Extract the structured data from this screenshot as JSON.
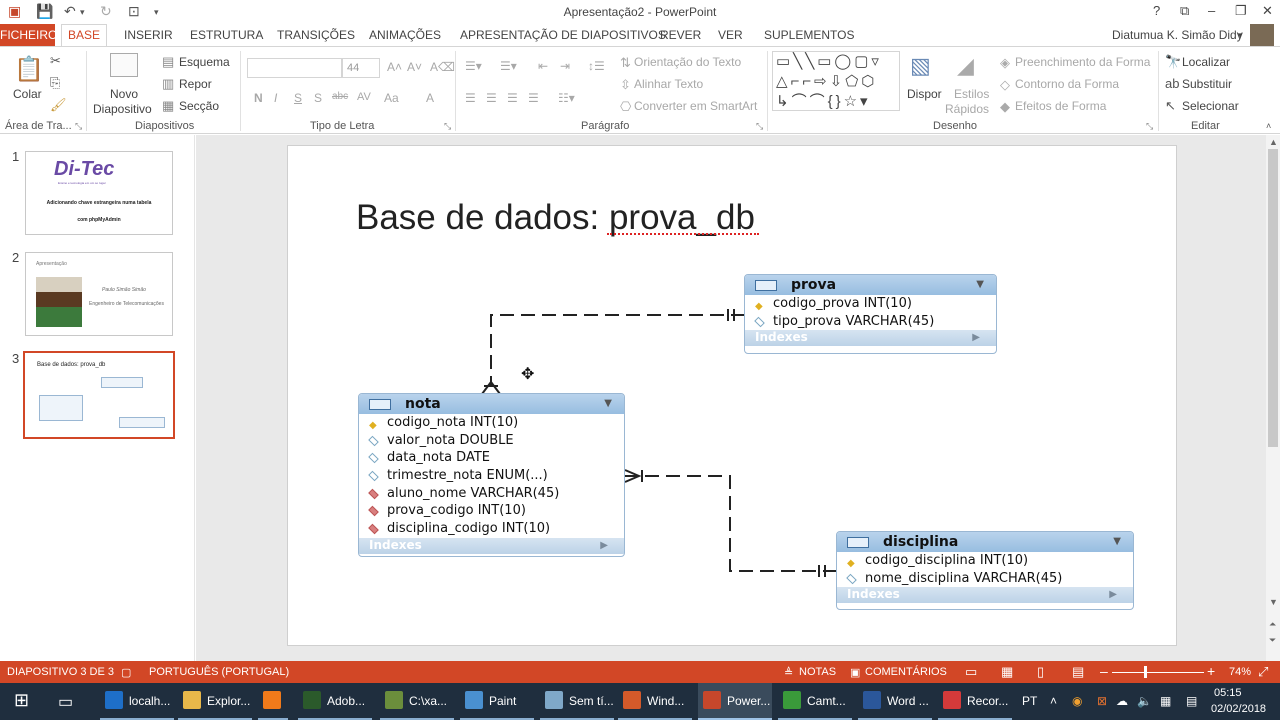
{
  "window": {
    "title": "Apresentação2 - PowerPoint",
    "controls": {
      "help": "?",
      "restore": "⧉",
      "minimize": "–",
      "maximize": "❐",
      "close": "✕"
    }
  },
  "quick_access": {
    "save_icon": "save-icon",
    "undo_icon": "undo-icon",
    "redo_icon": "redo-icon",
    "presentation_icon": "start-from-beginning-icon"
  },
  "tabs": [
    "FICHEIRO",
    "BASE",
    "INSERIR",
    "ESTRUTURA",
    "TRANSIÇÕES",
    "ANIMAÇÕES",
    "APRESENTAÇÃO DE DIAPOSITIVOS",
    "REVER",
    "VER",
    "SUPLEMENTOS"
  ],
  "user": {
    "name": "Diatumua K. Simão Didy"
  },
  "ribbon": {
    "clipboard": {
      "paste": "Colar",
      "group": "Área de Tra..."
    },
    "slides": {
      "new_slide_1": "Novo",
      "new_slide_2": "Diapositivo",
      "layout": "Esquema",
      "reset": "Repor",
      "section": "Secção",
      "group": "Diapositivos"
    },
    "font": {
      "size": "44",
      "bold": "N",
      "italic": "I",
      "underline": "S",
      "shadow": "S",
      "strike": "abc",
      "spacing": "AV",
      "case": "Aa",
      "color": "A",
      "group": "Tipo de Letra"
    },
    "paragraph": {
      "text_direction": "Orientação do Texto",
      "align_text": "Alinhar Texto",
      "smartart": "Converter em SmartArt",
      "group": "Parágrafo"
    },
    "drawing": {
      "arrange": "Dispor",
      "quick_styles_1": "Estilos",
      "quick_styles_2": "Rápidos",
      "fill": "Preenchimento da Forma",
      "outline": "Contorno da Forma",
      "effects": "Efeitos de Forma",
      "group": "Desenho"
    },
    "editing": {
      "find": "Localizar",
      "replace": "Substituir",
      "select": "Selecionar",
      "group": "Editar"
    }
  },
  "slides_panel": [
    {
      "num": "1",
      "logo": "Di-Tec",
      "tagline": "Ensino e tecnologia em um so lugar",
      "line1": "Adicionando chave estrangeira numa tabela",
      "line2": "com phpMyAdmin"
    },
    {
      "num": "2",
      "header": "Apresentação",
      "name": "Paulo Simão Simão",
      "role": "Engenheiro de Telecomunicações"
    },
    {
      "num": "3",
      "title": "Base de dados: prova_db",
      "selected": true
    }
  ],
  "slide": {
    "title": "Base de dados: prova_db",
    "tables": {
      "prova": {
        "name": "prova",
        "indexes": "Indexes",
        "columns": [
          {
            "text": "codigo_prova INT(10)",
            "kind": "pk"
          },
          {
            "text": "tipo_prova VARCHAR(45)",
            "kind": "col"
          }
        ]
      },
      "nota": {
        "name": "nota",
        "indexes": "Indexes",
        "columns": [
          {
            "text": "codigo_nota INT(10)",
            "kind": "pk"
          },
          {
            "text": "valor_nota DOUBLE",
            "kind": "col"
          },
          {
            "text": "data_nota DATE",
            "kind": "col"
          },
          {
            "text": "trimestre_nota ENUM(...)",
            "kind": "col"
          },
          {
            "text": "aluno_nome VARCHAR(45)",
            "kind": "fk"
          },
          {
            "text": "prova_codigo INT(10)",
            "kind": "fk"
          },
          {
            "text": "disciplina_codigo INT(10)",
            "kind": "fk"
          }
        ]
      },
      "disciplina": {
        "name": "disciplina",
        "indexes": "Indexes",
        "columns": [
          {
            "text": "codigo_disciplina INT(10)",
            "kind": "pk"
          },
          {
            "text": "nome_disciplina VARCHAR(45)",
            "kind": "col"
          }
        ]
      }
    }
  },
  "statusbar": {
    "slide_info": "DIAPOSITIVO 3 DE 3",
    "language": "PORTUGUÊS (PORTUGAL)",
    "notes": "NOTAS",
    "comments": "COMENTÁRIOS",
    "zoom": "74%"
  },
  "taskbar": {
    "items": [
      {
        "label": "localh...",
        "color": "#1e6fc8"
      },
      {
        "label": "Explor...",
        "color": "#e8b84a"
      },
      {
        "label": "",
        "color": "#f07a1a"
      },
      {
        "label": "Adob...",
        "color": "#2b5a2b"
      },
      {
        "label": "C:\\xa...",
        "color": "#6b8e3c"
      },
      {
        "label": "Paint",
        "color": "#4a90d0"
      },
      {
        "label": "Sem tí...",
        "color": "#7fa8c8"
      },
      {
        "label": "Wind...",
        "color": "#d45a2a"
      },
      {
        "label": "Power...",
        "color": "#c6472b"
      },
      {
        "label": "Camt...",
        "color": "#3a9a3a"
      },
      {
        "label": "Word ...",
        "color": "#2b579a"
      },
      {
        "label": "Recor...",
        "color": "#d43a3a"
      }
    ],
    "lang": "PT",
    "time": "05:15",
    "date": "02/02/2018"
  }
}
